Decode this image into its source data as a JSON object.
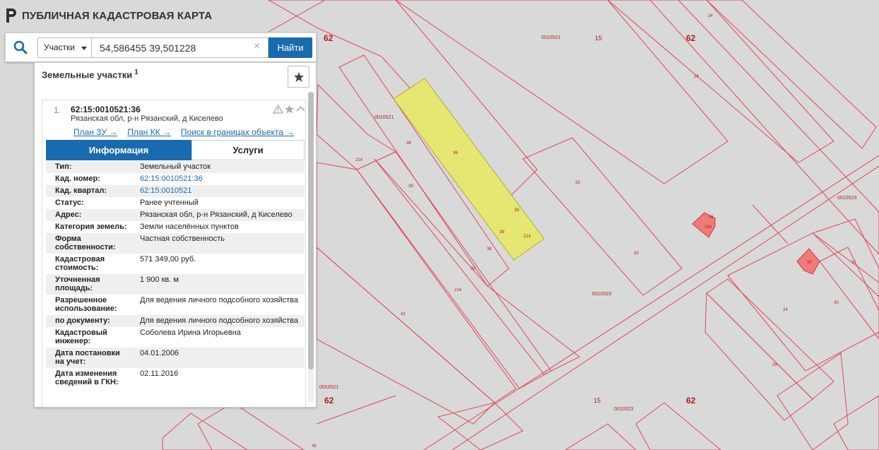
{
  "app": {
    "title": "ПУБЛИЧНАЯ КАДАСТРОВАЯ КАРТА"
  },
  "search": {
    "type_label": "Участки",
    "query": "54,586455 39,501228",
    "find_label": "Найти"
  },
  "panel": {
    "title": "Земельные участки",
    "count": "1"
  },
  "result": {
    "index": "1.",
    "cad_number": "62:15:0010521:36",
    "address": "Рязанская обл, р-н Рязанский, д Киселево",
    "links": [
      "План ЗУ →",
      "План КК →",
      "Поиск в границах объекта →"
    ],
    "tabs": [
      "Информация",
      "Услуги"
    ],
    "properties": [
      {
        "label": "Тип:",
        "value": "Земельный участок",
        "link": false
      },
      {
        "label": "Кад. номер:",
        "value": "62:15:0010521:36",
        "link": true
      },
      {
        "label": "Кад. квартал:",
        "value": "62:15:0010521",
        "link": true
      },
      {
        "label": "Статус:",
        "value": "Ранее учтенный",
        "link": false
      },
      {
        "label": "Адрес:",
        "value": "Рязанская обл, р-н Рязанский, д Киселево",
        "link": false
      },
      {
        "label": "Категория земель:",
        "value": "Земли населённых пунктов",
        "link": false
      },
      {
        "label": "Форма собственности:",
        "value": "Частная собственность",
        "link": false
      },
      {
        "label": "Кадастровая стоимость:",
        "value": "571 349,00 руб.",
        "link": false
      },
      {
        "label": "Уточненная площадь:",
        "value": "1 900 кв. м",
        "link": false
      },
      {
        "label": "Разрешенное использование:",
        "value": "Для ведения личного подсобного хозяйства",
        "link": false
      },
      {
        "label": "по документу:",
        "value": "Для ведения личного подсобного хозяйства",
        "link": false
      },
      {
        "label": "Кадастровый инженер:",
        "value": "Соболева Ирина Игорьевна",
        "link": false
      },
      {
        "label": "Дата постановки на учет:",
        "value": "04.01.2006",
        "link": false
      },
      {
        "label": "Дата изменения сведений в ГКН:",
        "value": "02.11.2016",
        "link": false
      }
    ]
  },
  "map": {
    "labels": [
      "62",
      "62",
      "62",
      "62",
      "15",
      "15",
      "0010521",
      "0010521",
      "0010521",
      "0010523",
      "0010523",
      "0010523",
      "24",
      "29",
      "38",
      "39",
      "214",
      "36",
      "38",
      "39",
      "214",
      "38",
      "39",
      "214",
      "41",
      "33",
      "33",
      "30",
      "31",
      "24",
      "29",
      "30",
      "280",
      "45",
      "36"
    ],
    "colors": {
      "background": "#d9d9d9",
      "parcel_line": "#e0475a",
      "selected_fill": "#e6e673",
      "building_fill": "#f07a7a",
      "label": "#b01e1e",
      "accent": "#1a6aaf"
    }
  }
}
